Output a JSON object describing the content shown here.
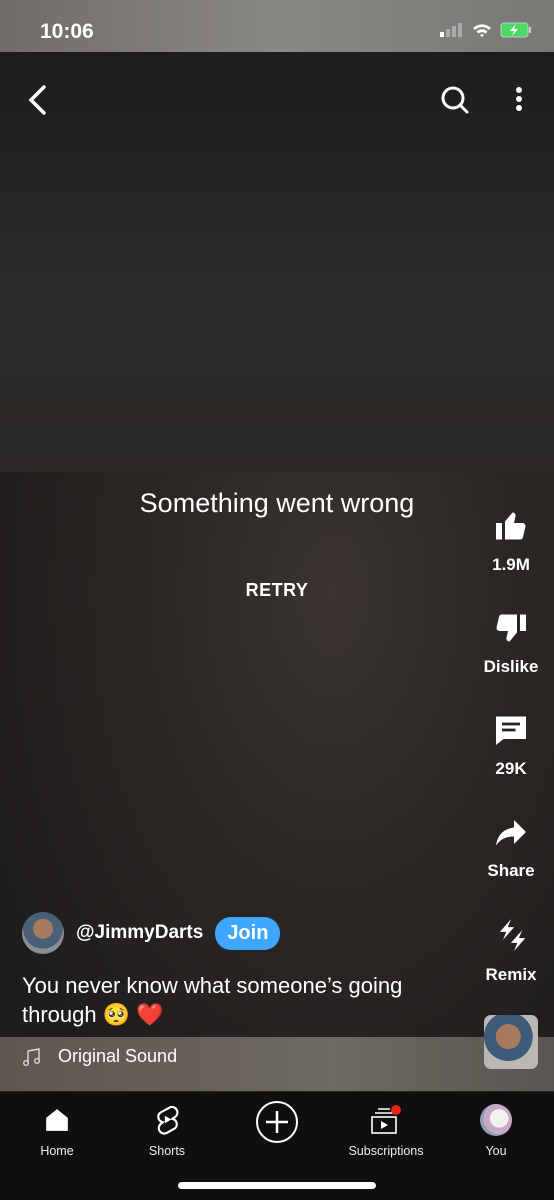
{
  "status": {
    "time": "10:06"
  },
  "player": {
    "error": "Something went wrong",
    "retry": "RETRY"
  },
  "actions": [
    {
      "id": "like",
      "label": "1.9M",
      "icon": "thumbs-up-icon"
    },
    {
      "id": "dislike",
      "label": "Dislike",
      "icon": "thumbs-down-icon"
    },
    {
      "id": "comments",
      "label": "29K",
      "icon": "comment-icon"
    },
    {
      "id": "share",
      "label": "Share",
      "icon": "share-icon"
    },
    {
      "id": "remix",
      "label": "Remix",
      "icon": "remix-icon"
    }
  ],
  "channel": {
    "handle": "@JimmyDarts",
    "join": "Join"
  },
  "caption": "You never know what someone’s going through 🥺 ❤️",
  "sound": "Original Sound",
  "nav": [
    {
      "label": "Home"
    },
    {
      "label": "Shorts"
    },
    {
      "label": ""
    },
    {
      "label": "Subscriptions"
    },
    {
      "label": "You"
    }
  ],
  "colors": {
    "join": "#3ea6ff",
    "badge": "#e62117",
    "battery": "#4cd964"
  }
}
